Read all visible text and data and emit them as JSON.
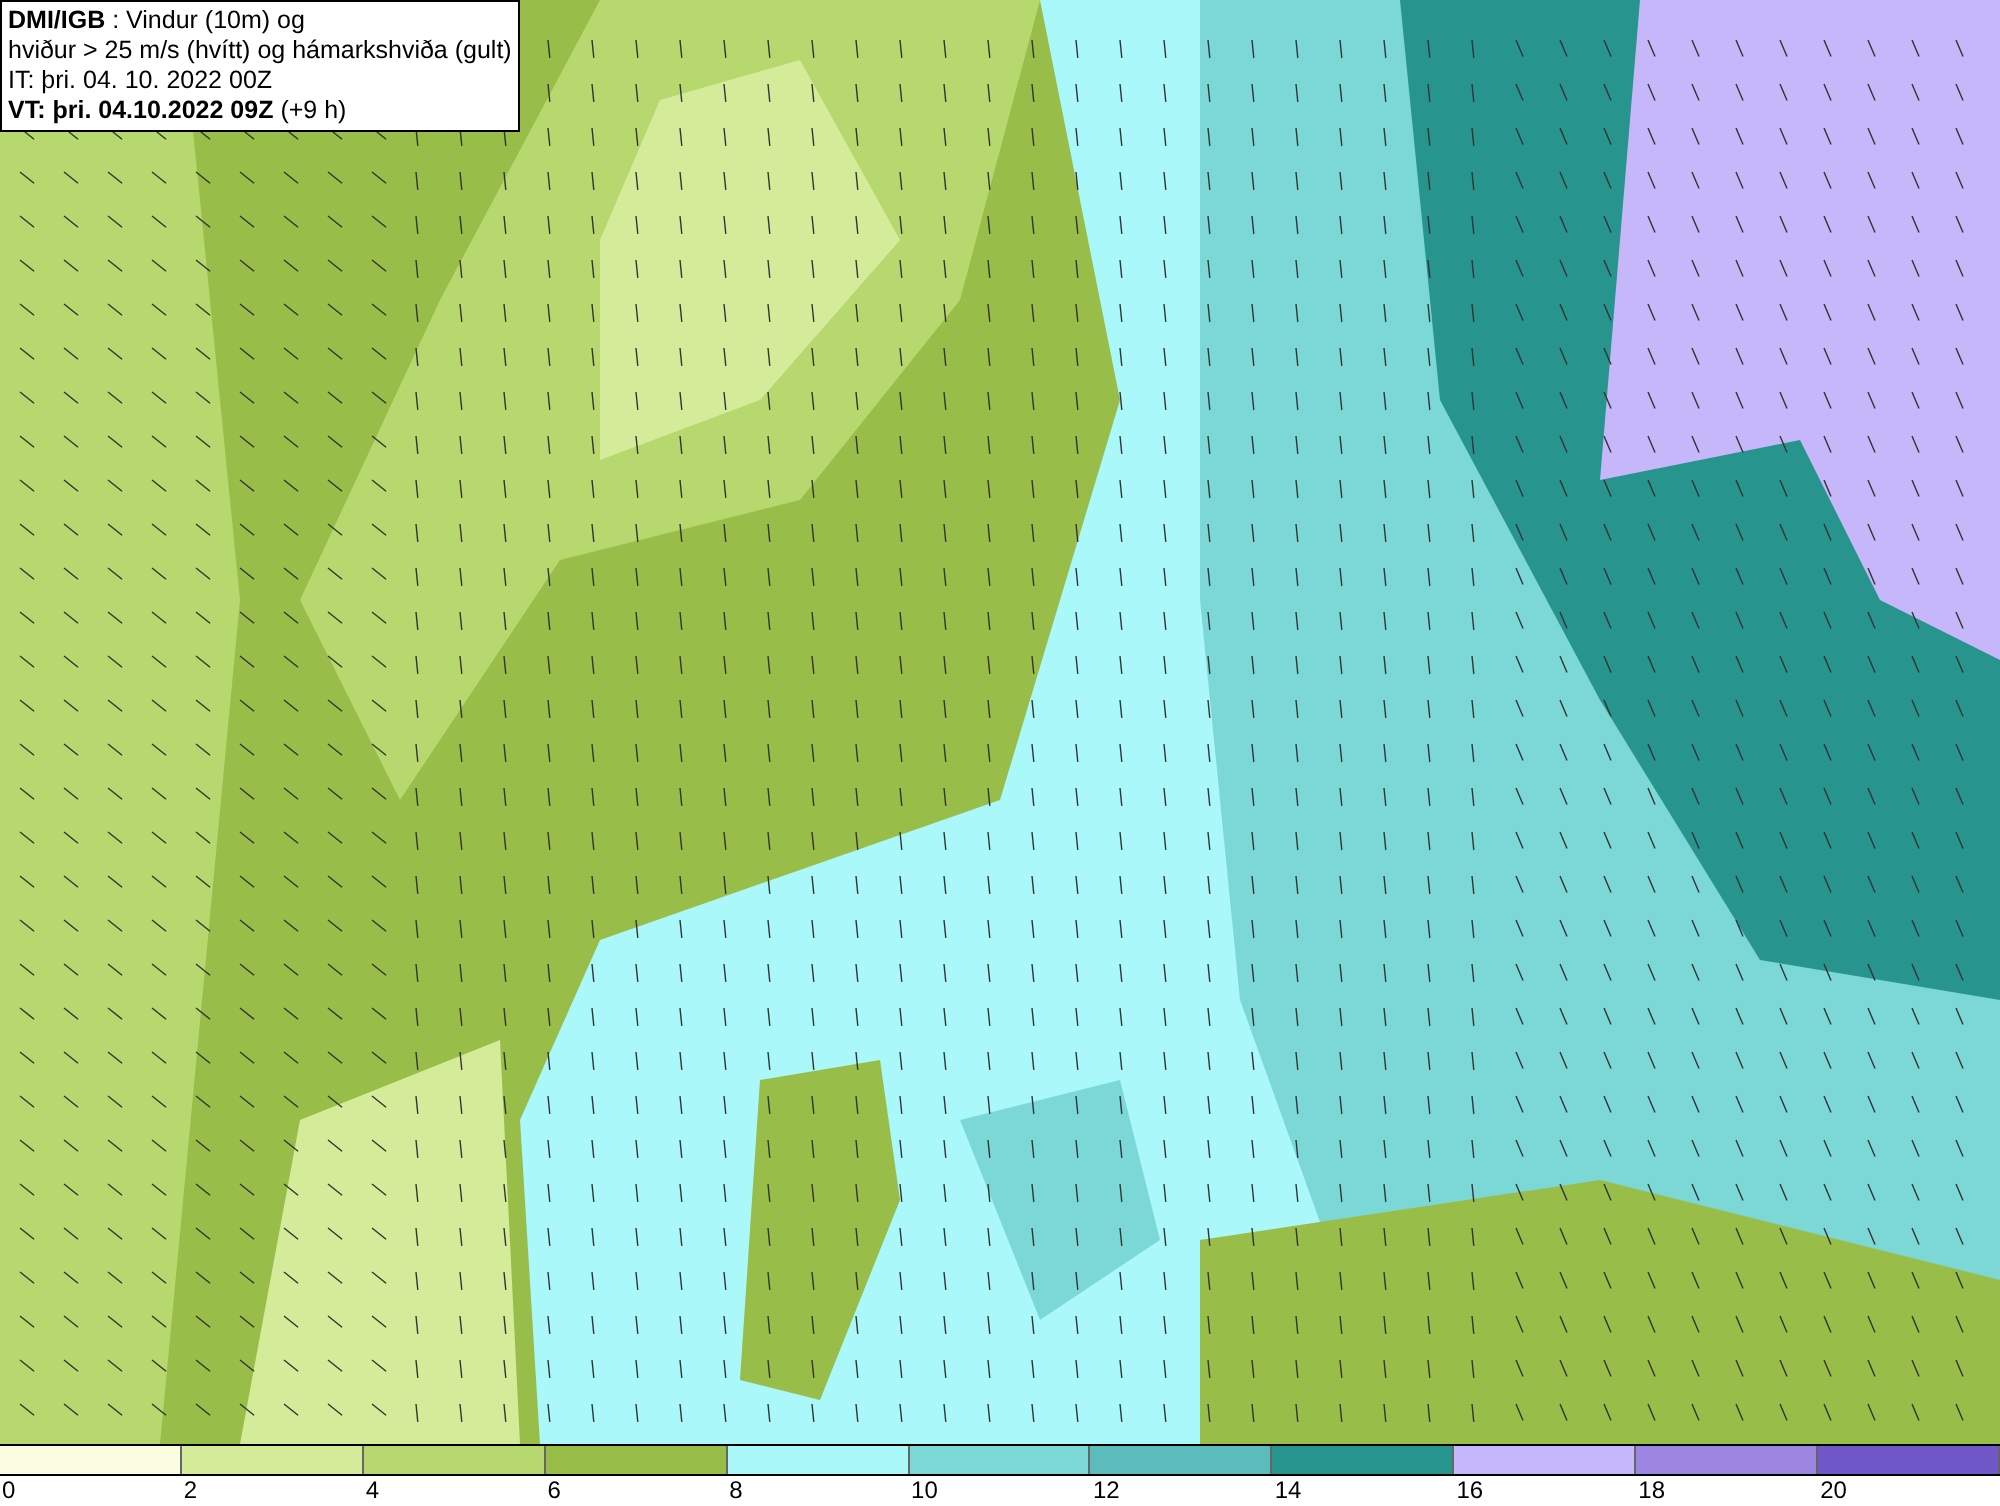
{
  "title_box": {
    "lines": [
      "**DMI/IGB** : Vindur (10m) og",
      "hviður > 25 m/s (hvítt) og hámarkshviða (gult)",
      "IT: þri. 04. 10. 2022 00Z",
      "**VT: þri. 04.10.2022 09Z** (+9 h)"
    ]
  },
  "legend": {
    "bins": [
      {
        "label": "0",
        "color": "#fafde0"
      },
      {
        "label": "2",
        "color": "#d4ec9a"
      },
      {
        "label": "4",
        "color": "#b6d86e"
      },
      {
        "label": "6",
        "color": "#98bd48"
      },
      {
        "label": "8",
        "color": "#aaf8fa"
      },
      {
        "label": "10",
        "color": "#7cd8d6"
      },
      {
        "label": "12",
        "color": "#5cbcbc"
      },
      {
        "label": "14",
        "color": "#28948e"
      },
      {
        "label": "16",
        "color": "#c6b6fa"
      },
      {
        "label": "18",
        "color": "#9c86e2"
      },
      {
        "label": "20",
        "color": "#7058c8"
      }
    ]
  }
}
